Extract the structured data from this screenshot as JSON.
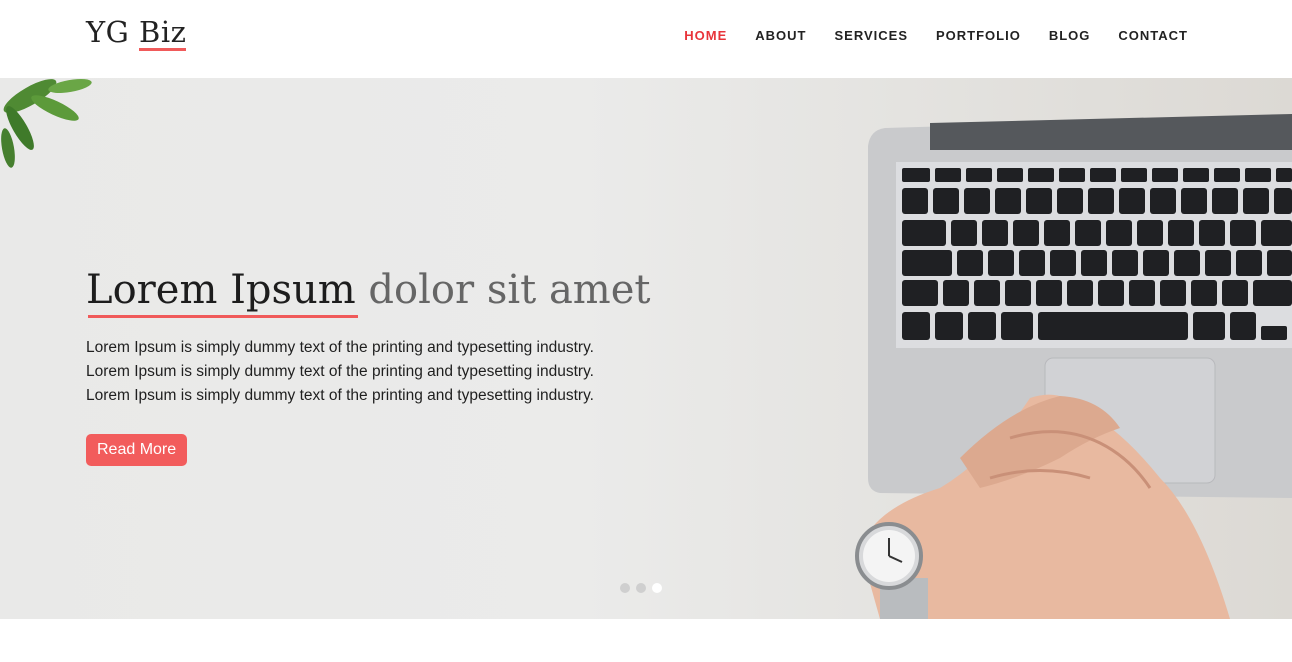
{
  "header": {
    "logo_part1": "YG ",
    "logo_part2": "Biz",
    "nav": [
      {
        "label": "HOME",
        "active": true
      },
      {
        "label": "ABOUT"
      },
      {
        "label": "SERVICES"
      },
      {
        "label": "PORTFOLIO"
      },
      {
        "label": "BLOG"
      },
      {
        "label": "CONTACT"
      }
    ]
  },
  "hero": {
    "title_strong": "Lorem Ipsum",
    "title_light": " dolor sit amet",
    "lines": [
      "Lorem Ipsum is simply dummy text of the printing and typesetting industry.",
      "Lorem Ipsum is simply dummy text of the printing and typesetting industry.",
      "Lorem Ipsum is simply dummy text of the printing and typesetting industry."
    ],
    "button_label": "Read More",
    "slides_total": 3,
    "active_slide": 3
  },
  "colors": {
    "accent": "#f25c5c",
    "nav_active": "#e8343a"
  }
}
